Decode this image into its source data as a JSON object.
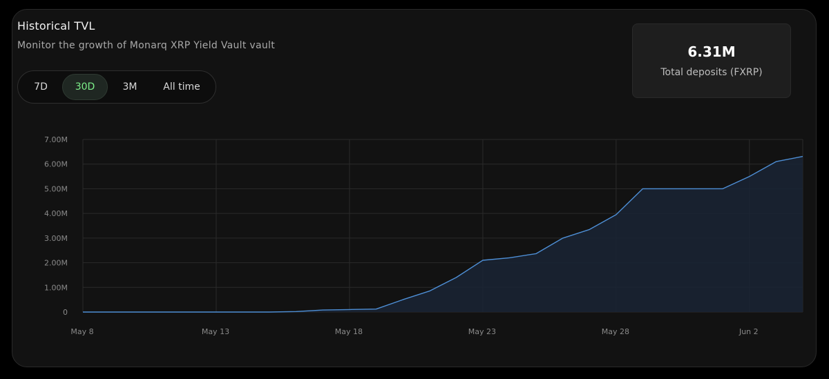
{
  "header": {
    "title": "Historical TVL",
    "subtitle": "Monitor the growth of Monarq XRP Yield Vault vault"
  },
  "range_tabs": [
    {
      "label": "7D",
      "active": false
    },
    {
      "label": "30D",
      "active": true
    },
    {
      "label": "3M",
      "active": false
    },
    {
      "label": "All time",
      "active": false
    }
  ],
  "stat": {
    "value": "6.31M",
    "label": "Total deposits (FXRP)"
  },
  "colors": {
    "line": "#4e8fd6",
    "area": "#1a2433",
    "active_tab_text": "#7df08a"
  },
  "chart_data": {
    "type": "area",
    "title": "",
    "xlabel": "",
    "ylabel": "",
    "x_ticks": [
      "May 8",
      "May 13",
      "May 18",
      "May 23",
      "May 28",
      "Jun 2"
    ],
    "y_ticks": [
      "0",
      "1.00M",
      "2.00M",
      "3.00M",
      "4.00M",
      "5.00M",
      "6.00M",
      "7.00M"
    ],
    "ylim": [
      0,
      7000000
    ],
    "grid": true,
    "series": [
      {
        "x": [
          "May 8",
          "May 9",
          "May 10",
          "May 11",
          "May 12",
          "May 13",
          "May 14",
          "May 15",
          "May 16",
          "May 17",
          "May 18",
          "May 19",
          "May 20",
          "May 21",
          "May 22",
          "May 23",
          "May 24",
          "May 25",
          "May 26",
          "May 27",
          "May 28",
          "May 29",
          "May 30",
          "May 31",
          "Jun 1",
          "Jun 2",
          "Jun 3",
          "Jun 4"
        ],
        "values": [
          0,
          0,
          0,
          0,
          0,
          0,
          0,
          0,
          20000,
          80000,
          100000,
          120000,
          500000,
          850000,
          1400000,
          2100000,
          2200000,
          2370000,
          3000000,
          3350000,
          3950000,
          5000000,
          5000000,
          5000000,
          5000000,
          5500000,
          6100000,
          6310000
        ]
      }
    ]
  }
}
